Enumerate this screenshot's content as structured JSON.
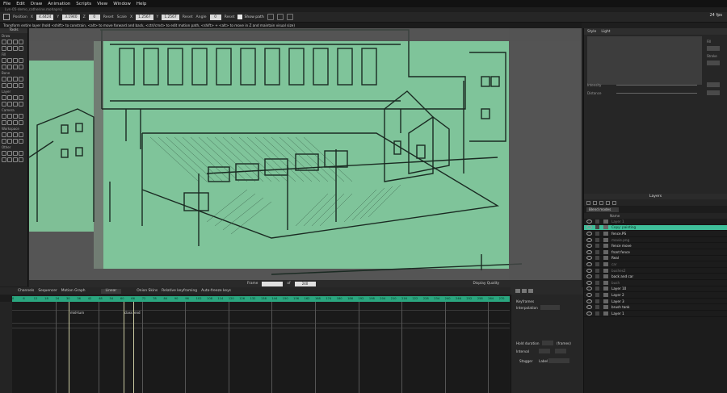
{
  "menu": [
    "File",
    "Edit",
    "Draw",
    "Animation",
    "Scripts",
    "View",
    "Window",
    "Help"
  ],
  "filename": "Lvn-05-demo_catherine.mohaproj",
  "tool_options": {
    "position_label": "Position",
    "x_label": "X",
    "x_value": "4.4424",
    "y_label": "Y",
    "y_value": "3.1940",
    "z_label": "Z",
    "z_value": "0",
    "reset1": "Reset",
    "scale_label": "Scale",
    "sx_value": "1.2567",
    "sy_value": "1.2567",
    "reset2": "Reset",
    "angle_label": "Angle",
    "angle_value": "0",
    "reset3": "Reset",
    "show_path": "Show path"
  },
  "fps": "24 fps",
  "hint": "Transform entire layer (hold <shift> to constrain, <alt> to move forward and back, <ctrl/cmd> to edit motion path, <shift> + <alt> to move in Z and maintain visual size)",
  "tools": {
    "header": "Tools",
    "sections": [
      "Draw",
      "Fill",
      "Bone",
      "Layer",
      "Camera",
      "Workspace",
      "Other"
    ]
  },
  "viewport_status": {
    "frame_label": "Frame",
    "frame_value": "1",
    "of_label": "of",
    "end_value": "240",
    "display_quality": "Display Quality"
  },
  "style_panel": {
    "tabs": [
      "Style",
      "Light"
    ],
    "fill_label": "Fill",
    "stroke_label": "Stroke",
    "intensity_label": "Intensity",
    "distance_label": "Distance"
  },
  "layers": {
    "title": "Layers",
    "blend_mode": "Blend modes",
    "name_header": "Name",
    "items": [
      {
        "name": "Layer 1",
        "state": "dim"
      },
      {
        "name": "Copy: painting",
        "state": "sel"
      },
      {
        "name": "fence.PS",
        "state": "normal"
      },
      {
        "name": "movie.png",
        "state": "dim"
      },
      {
        "name": "fence move",
        "state": "normal"
      },
      {
        "name": "front fence",
        "state": "normal"
      },
      {
        "name": "Real",
        "state": "normal"
      },
      {
        "name": "car",
        "state": "dim"
      },
      {
        "name": "bushes2",
        "state": "dim"
      },
      {
        "name": "back and car",
        "state": "normal"
      },
      {
        "name": "bush",
        "state": "dim"
      },
      {
        "name": "Layer 10",
        "state": "normal"
      },
      {
        "name": "Layer 2",
        "state": "normal"
      },
      {
        "name": "Layer 3",
        "state": "normal"
      },
      {
        "name": "brush tank",
        "state": "normal"
      },
      {
        "name": "Layer 1",
        "state": "normal"
      }
    ]
  },
  "timeline": {
    "tabs": [
      "Channels",
      "Sequencer",
      "Motion Graph"
    ],
    "interp": "Linear",
    "onion": "Onion Skins",
    "relative": "Relative keyframing",
    "auto_freeze": "Auto-freeze keys",
    "ruler": [
      "0",
      "6",
      "12",
      "18",
      "24",
      "30",
      "36",
      "42",
      "48",
      "54",
      "60",
      "66",
      "72",
      "78",
      "84",
      "90",
      "96",
      "102",
      "108",
      "114",
      "120",
      "126",
      "132",
      "138",
      "144",
      "150",
      "156",
      "162",
      "168",
      "174",
      "180",
      "186",
      "192",
      "198",
      "204",
      "210",
      "216",
      "222",
      "228",
      "234",
      "240",
      "246",
      "252",
      "258",
      "264",
      "270"
    ],
    "labels": [
      "mid-turn",
      "class",
      "end"
    ]
  },
  "keyframes_panel": {
    "title": "Keyframes",
    "interpolation": "Interpolation",
    "hold_duration": "Hold duration",
    "frames": "(frames)",
    "interval": "Interval",
    "stagger": "Stagger",
    "label": "Label"
  }
}
